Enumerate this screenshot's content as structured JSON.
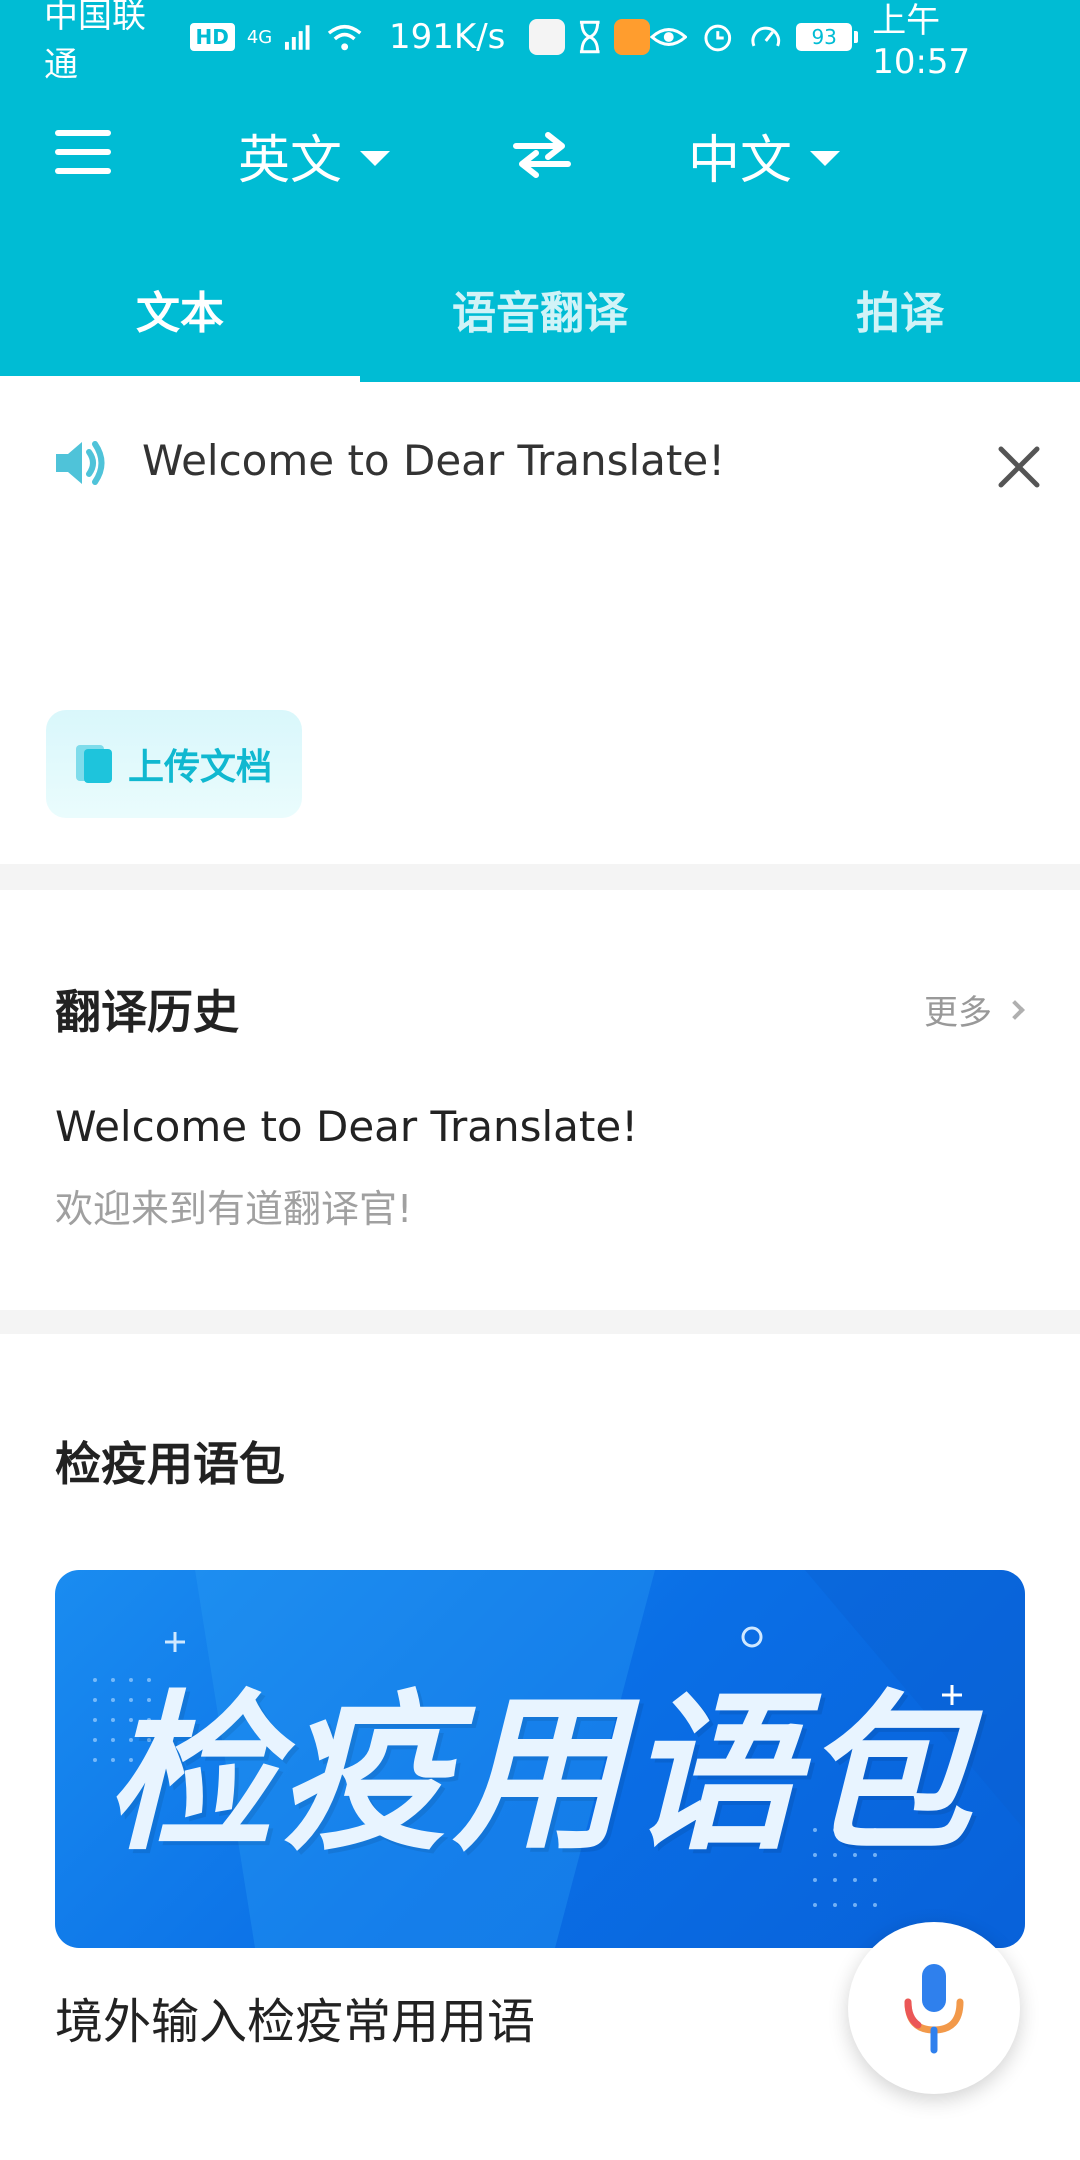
{
  "status_bar": {
    "carrier": "中国联通",
    "hd_badge": "HD",
    "network": "4G",
    "speed": "191K/s",
    "battery": "93",
    "time": "上午10:57"
  },
  "toolbar": {
    "source_language": "英文",
    "target_language": "中文"
  },
  "tabs": [
    {
      "label": "文本",
      "active": true
    },
    {
      "label": "语音翻译",
      "active": false
    },
    {
      "label": "拍译",
      "active": false
    }
  ],
  "input": {
    "text": "Welcome to Dear Translate!",
    "upload_label": "上传文档"
  },
  "history": {
    "title": "翻译历史",
    "more_label": "更多",
    "items": [
      {
        "source": "Welcome to Dear Translate!",
        "translation": "欢迎来到有道翻译官!"
      }
    ]
  },
  "phrasebook": {
    "title": "检疫用语包",
    "banner_title": "检疫用语包",
    "subtitle": "境外输入检疫常用用语"
  },
  "colors": {
    "primary": "#00bcd4",
    "accent": "#10b8d0",
    "banner": "#0a6fe6"
  },
  "icons": [
    "menu-icon",
    "swap-icon",
    "speaker-icon",
    "close-icon",
    "document-icon",
    "chevron-right-icon",
    "mic-icon"
  ]
}
